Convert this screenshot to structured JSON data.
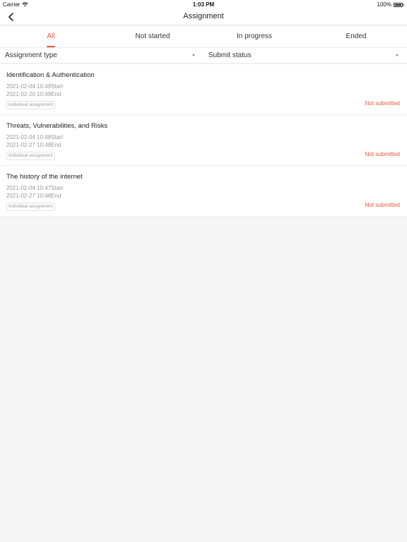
{
  "status_bar": {
    "carrier": "Carrier",
    "time": "1:03 PM",
    "battery": "100%"
  },
  "nav": {
    "title": "Assignment"
  },
  "tabs": [
    {
      "label": "All",
      "active": true
    },
    {
      "label": "Not started",
      "active": false
    },
    {
      "label": "In progress",
      "active": false
    },
    {
      "label": "Ended",
      "active": false
    }
  ],
  "filters": {
    "type_label": "Assignment type",
    "status_label": "Submit status"
  },
  "assignments": [
    {
      "title": "Identification & Authentication",
      "start": "2021-02-04 10:49Start",
      "end": "2021-02-20 10:49End",
      "tag": "Individual assignment",
      "status": "Not submitted"
    },
    {
      "title": "Threats, Vulnerabilities, and Risks",
      "start": "2021-02-04 10:48Start",
      "end": "2021-02-27 10:48End",
      "tag": "Individual assignment",
      "status": "Not submitted"
    },
    {
      "title": "The history of the internet",
      "start": "2021-02-04 10:47Start",
      "end": "2021-02-27 10:48End",
      "tag": "Individual assignment",
      "status": "Not submitted"
    }
  ],
  "colors": {
    "accent": "#e8553e",
    "background": "#f5f5f5",
    "muted_text": "#999999"
  },
  "icons": {
    "back": "chevron-left-icon",
    "wifi": "wifi-icon",
    "battery": "battery-icon",
    "dropdown": "caret-down-icon"
  }
}
